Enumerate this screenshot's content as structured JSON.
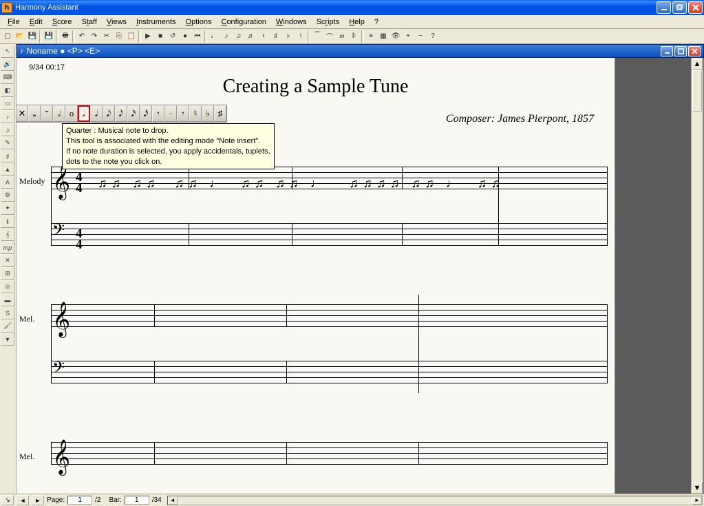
{
  "app": {
    "title": "Harmony Assistant"
  },
  "menu": {
    "items": [
      "File",
      "Edit",
      "Score",
      "Staff",
      "Views",
      "Instruments",
      "Options",
      "Configuration",
      "Windows",
      "Scripts",
      "Help",
      "?"
    ]
  },
  "document": {
    "title": "Noname ● <P> <E>",
    "timestamp": "9/34 00:17",
    "score_title": "Creating a Sample Tune",
    "composer": "Composer: James Pierpont, 1857"
  },
  "tooltip": {
    "line1": "Quarter : Musical note to drop.",
    "line2": " This tool is associated with the editing mode \"Note insert\".",
    "line3": "If no note duration is selected, you apply accidentals, tuplets,",
    "line4": "dots to the note you click on."
  },
  "staves": {
    "system1_label": "Melody",
    "system2_label": "Mel.",
    "system3_label": "Mel.",
    "time_num": "4",
    "time_den": "4"
  },
  "note_palette": {
    "items": [
      "✕",
      "𝅝",
      "𝄻",
      "𝅗𝅥",
      "o",
      "𝅘𝅥",
      "𝅘𝅥",
      "𝅘𝅥𝅮",
      "𝅘𝅥𝅮",
      "𝅘𝅥𝅯",
      "𝅘𝅥𝅯",
      "𝄾",
      "·",
      "𝄾",
      "♮",
      "♭",
      "♯"
    ],
    "selected_index": 5
  },
  "statusbar": {
    "page_label": "Page:",
    "page_value": "1",
    "page_total": "/2",
    "bar_label": "Bar:",
    "bar_value": "1",
    "bar_total": "/34"
  }
}
